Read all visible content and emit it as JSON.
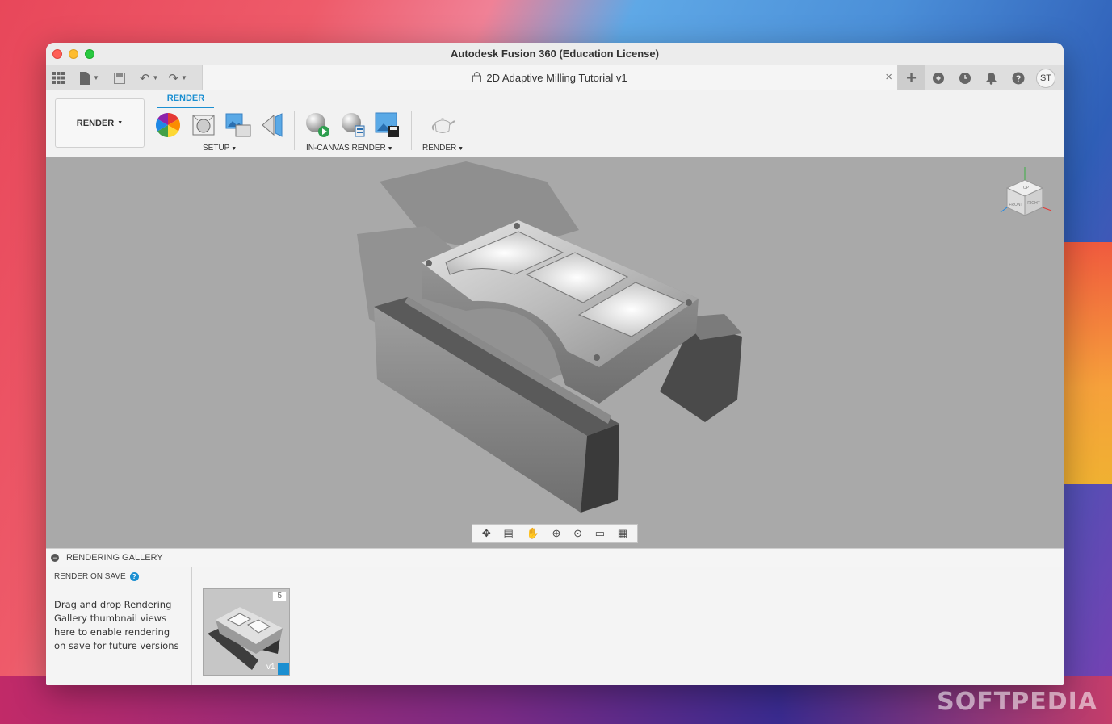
{
  "window": {
    "title": "Autodesk Fusion 360 (Education License)"
  },
  "tabbar": {
    "document_tab": "2D Adaptive Milling Tutorial v1",
    "user_initials": "ST"
  },
  "toolbar": {
    "workspace_button": "RENDER",
    "active_tab": "RENDER",
    "groups": {
      "setup": "SETUP",
      "in_canvas_render": "IN-CANVAS RENDER",
      "render": "RENDER"
    }
  },
  "viewcube": {
    "front": "FRONT",
    "right": "RIGHT",
    "top": "TOP"
  },
  "gallery": {
    "header": "RENDERING GALLERY",
    "render_on_save": "RENDER ON SAVE",
    "description": "Drag and drop Rendering Gallery thumbnail views here to enable rendering on save for future versions",
    "thumbnail": {
      "count": "5",
      "version": "v1"
    }
  },
  "watermark": "SOFTPEDIA",
  "colors": {
    "accent": "#1b8fd1",
    "viewport_bg": "#a9a9a9"
  }
}
